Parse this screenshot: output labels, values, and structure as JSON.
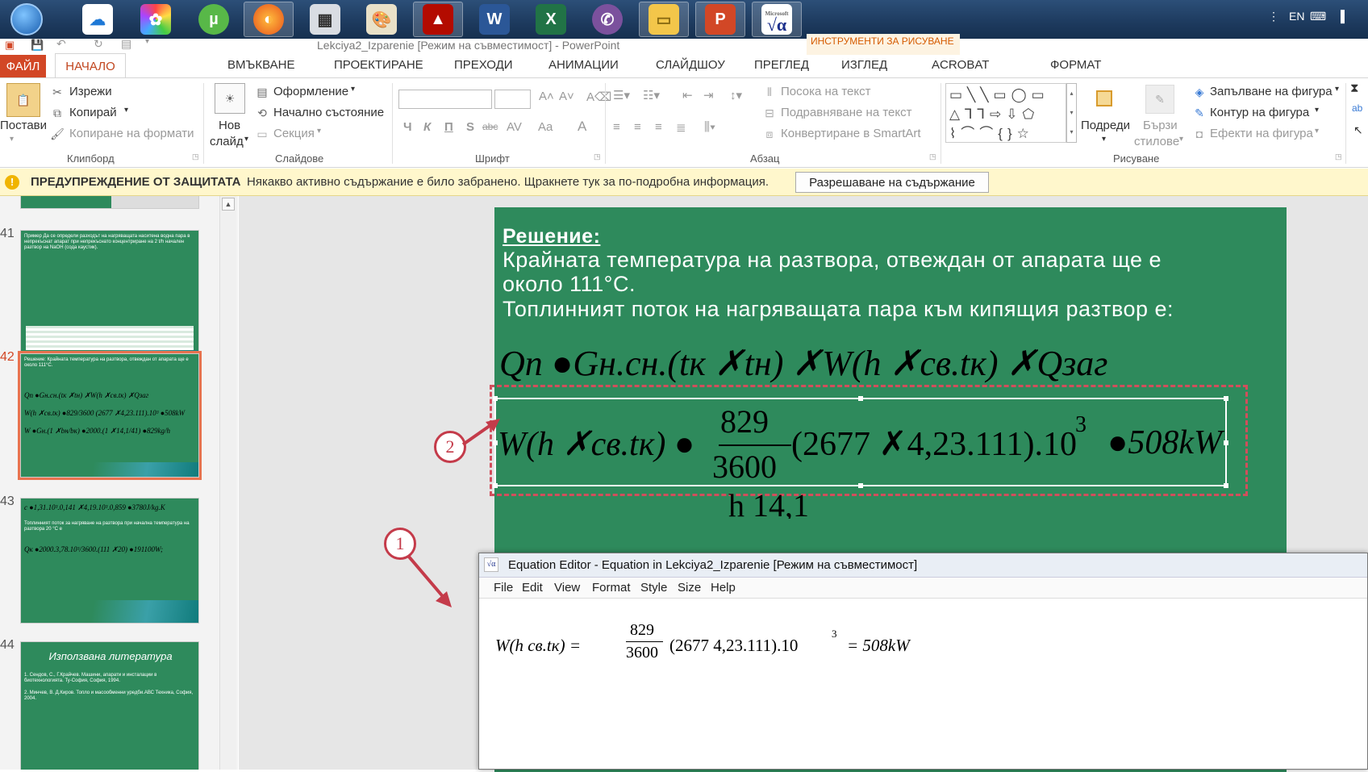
{
  "taskbar": {
    "icons": [
      "windows-start-icon",
      "onedrive-icon",
      "photos-icon",
      "utorrent-icon",
      "firefox-icon",
      "calculator-icon",
      "paint-icon",
      "acrobat-icon",
      "word-icon",
      "excel-icon",
      "viber-icon",
      "explorer-icon",
      "powerpoint-icon",
      "equation-editor-icon"
    ],
    "lang": "EN",
    "eq_icon_label": "Microsoft"
  },
  "window": {
    "title": "Lekciya2_Izparenie [Режим на съвместимост] - PowerPoint",
    "drawing_tools": "ИНСТРУМЕНТИ ЗА РИСУВАНЕ"
  },
  "tabs": [
    "ФАЙЛ",
    "НАЧАЛО",
    "ВМЪКВАНЕ",
    "ПРОЕКТИРАНЕ",
    "ПРЕХОДИ",
    "АНИМАЦИИ",
    "СЛАЙДШОУ",
    "ПРЕГЛЕД",
    "ИЗГЛЕД",
    "ACROBAT",
    "ФОРМАТ"
  ],
  "ribbon": {
    "clipboard": {
      "paste": "Постави",
      "cut": "Изрежи",
      "copy": "Копирай",
      "format_painter": "Копиране на формати",
      "group": "Клипборд"
    },
    "slides": {
      "new_slide": "Нов",
      "new_slide2": "слайд",
      "layout": "Оформление",
      "reset": "Начално състояние",
      "section": "Секция",
      "group": "Слайдове"
    },
    "font": {
      "group": "Шрифт",
      "bold": "Ч",
      "italic": "К",
      "underline": "П",
      "shadow": "S",
      "strike": "abc",
      "spacing": "AV",
      "case": "Aa",
      "color": "A"
    },
    "paragraph": {
      "text_direction": "Посока на текст",
      "align_text": "Подравняване на текст",
      "smartart": "Конвертиране в SmartArt",
      "group": "Абзац"
    },
    "drawing": {
      "arrange": "Подреди",
      "quick_styles": "Бързи",
      "quick_styles2": "стилове",
      "fill": "Запълване на фигура",
      "outline": "Контур на фигура",
      "effects": "Ефекти на фигура",
      "group": "Рисуване"
    }
  },
  "warning": {
    "title": "ПРЕДУПРЕЖДЕНИЕ ОТ ЗАЩИТАТА",
    "message": "Някакво активно съдържание е било забранено. Щракнете тук за по-подробна информация.",
    "button": "Разрешаване на съдържание"
  },
  "thumbnails": [
    {
      "num": "41",
      "text": "Пример Да се определи разходът на нагряващата наситена водна пара в непрекъснат апарат при непрекъснато концентриране на 2 t/h начален разтвор на NaOH (сода каустик)."
    },
    {
      "num": "42",
      "text": "Решение: Крайната температура на разтвора, отвеждан от апарата ще е около 111°С."
    },
    {
      "num": "43",
      "text": "Топлинният поток за нагряване на разтвора при начална температура на разтвора 20 °С е"
    },
    {
      "num": "44",
      "title": "Използвана литература",
      "items": [
        "1. Сендов, С., Г.Крайчев. Машини, апарати и инсталации в биотехнологията. Ту-София, София, 1994.",
        "2. Минчев, В. Д.Киров. Топло и масообменни уредби.АВС Техника, София, 2004."
      ]
    }
  ],
  "slide": {
    "heading": "Решение:",
    "line1": "Крайната температура на разтвора, отвеждан от апарата ще е",
    "line2": "около 111°С.",
    "line3": "Топлинният поток на нагряващата пара към кипящия разтвор е:",
    "eq1": "Qn ●Gн.cн.(tк ✗tн) ✗W(h ✗cв.tк) ✗Qзаг",
    "eq2_left": "W(h ✗cв.tк) ●",
    "eq2_num": "829",
    "eq2_den": "3600",
    "eq2_right": "(2677 ✗4,23.111).10",
    "eq2_exp": "3",
    "eq2_end": "●508kW",
    "eq3_partial": "h                          14,1"
  },
  "dialog": {
    "title": "Equation Editor - Equation in Lekciya2_Izparenie [Режим на съвместимост]",
    "menu": [
      "File",
      "Edit",
      "View",
      "Format",
      "Style",
      "Size",
      "Help"
    ],
    "eq_left": "W(h    cв.tк) =",
    "eq_num": "829",
    "eq_den": "3600",
    "eq_right": "(2677     4,23.111).10",
    "eq_exp": "3",
    "eq_end": "= 508kW"
  },
  "callouts": [
    "1",
    "2"
  ],
  "colors": {
    "slide_green": "#2e8a5c",
    "accent": "#d24726",
    "callout": "#c43b4a"
  }
}
